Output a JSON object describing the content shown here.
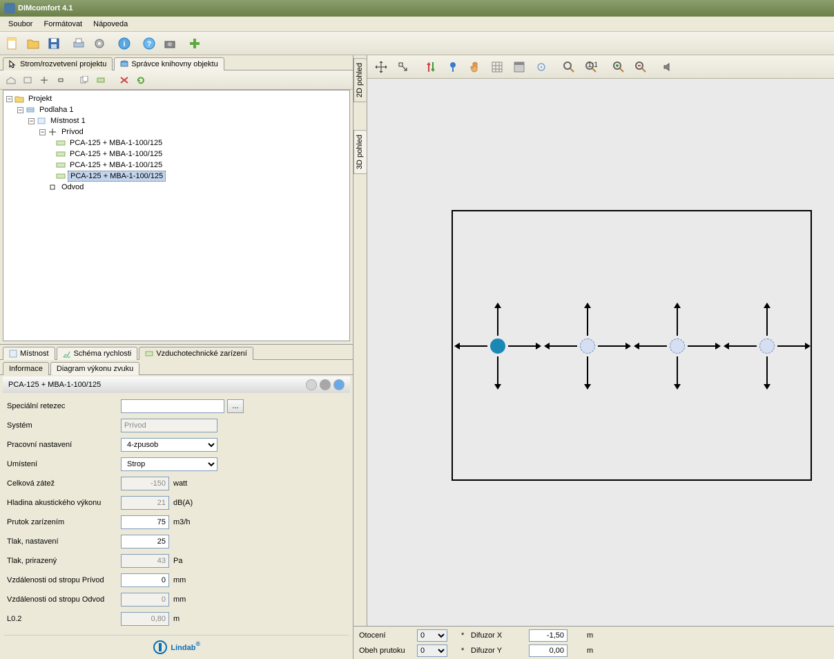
{
  "title": "DIMcomfort 4.1",
  "menu": {
    "file": "Soubor",
    "format": "Formátovat",
    "help": "Nápoveda"
  },
  "leftTabs": {
    "tree": "Strom/rozvetvení projektu",
    "library": "Správce knihovny objektu"
  },
  "tree": {
    "root": "Projekt",
    "floor": "Podlaha 1",
    "room": "Místnost 1",
    "supply": "Prívod",
    "items": [
      "PCA-125 + MBA-1-100/125",
      "PCA-125 + MBA-1-100/125",
      "PCA-125 + MBA-1-100/125",
      "PCA-125 + MBA-1-100/125"
    ],
    "selectedIndex": 3,
    "exhaust": "Odvod"
  },
  "midTabs": {
    "room": "Místnost",
    "velocity": "Schéma rychlosti",
    "hvac": "Vzduchotechnické zarízení"
  },
  "subTabs": {
    "info": "Informace",
    "sound": "Diagram výkonu zvuku"
  },
  "device": {
    "header": "PCA-125 + MBA-1-100/125",
    "fields": {
      "special_label": "Speciální retezec",
      "special_value": "",
      "system_label": "Systém",
      "system_value": "Prívod",
      "work_label": "Pracovní nastavení",
      "work_value": "4-zpusob",
      "place_label": "Umístení",
      "place_value": "Strop",
      "load_label": "Celková zátež",
      "load_value": "-150",
      "load_unit": "watt",
      "acoustic_label": "Hladina akustického výkonu",
      "acoustic_value": "21",
      "acoustic_unit": "dB(A)",
      "flow_label": "Prutok zarízením",
      "flow_value": "75",
      "flow_unit": "m3/h",
      "pressure_set_label": "Tlak, nastavení",
      "pressure_set_value": "25",
      "pressure_assigned_label": "Tlak, prirazený",
      "pressure_assigned_value": "43",
      "pressure_unit": "Pa",
      "dist_supply_label": "Vzdálenosti od stropu Prívod",
      "dist_supply_value": "0",
      "dist_unit": "mm",
      "dist_exhaust_label": "Vzdálenosti od stropu Odvod",
      "dist_exhaust_value": "0",
      "l02_label": "L0.2",
      "l02_value": "0,80",
      "l02_unit": "m"
    }
  },
  "logo": "Lindab",
  "vtabs": {
    "v2d": "2D pohled",
    "v3d": "3D pohled"
  },
  "rightFoot": {
    "rotation_label": "Otocení",
    "rotation_value": "0",
    "rotation_unit": "*",
    "flow_label": "Obeh prutoku",
    "flow_value": "0",
    "flow_unit": "*",
    "diffx_label": "Difuzor X",
    "diffx_value": "-1,50",
    "diffx_unit": "m",
    "diffy_label": "Difuzor Y",
    "diffy_value": "0,00",
    "diffy_unit": "m"
  }
}
